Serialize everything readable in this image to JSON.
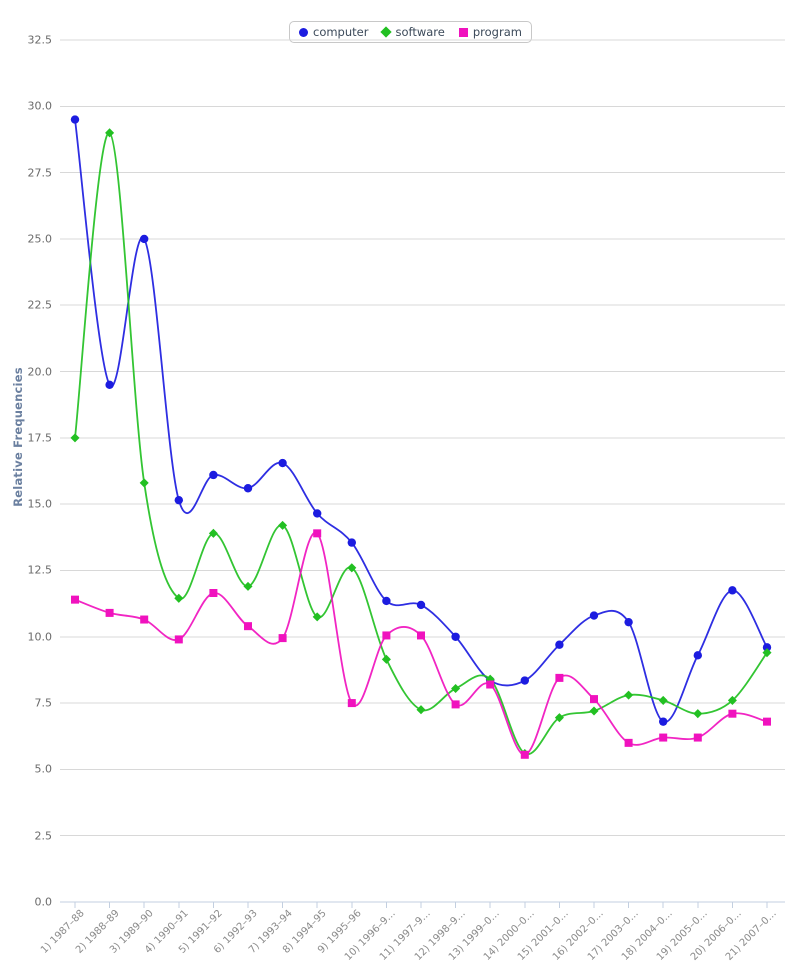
{
  "legend": {
    "position": "top-center",
    "items": [
      {
        "label": "computer",
        "color": "#1c1ce0",
        "marker": "circle-marker-icon"
      },
      {
        "label": "software",
        "color": "#22c022",
        "marker": "diamond-marker-icon"
      },
      {
        "label": "program",
        "color": "#f012be",
        "marker": "square-marker-icon"
      }
    ]
  },
  "chart_data": {
    "type": "line",
    "title": "",
    "xlabel": "",
    "ylabel": "Relative Frequencies",
    "ylim": [
      0.0,
      32.5
    ],
    "yticks": [
      "0.0",
      "2.5",
      "5.0",
      "7.5",
      "10.0",
      "12.5",
      "15.0",
      "17.5",
      "20.0",
      "22.5",
      "25.0",
      "27.5",
      "30.0",
      "32.5"
    ],
    "ytick_values": [
      0.0,
      2.5,
      5.0,
      7.5,
      10.0,
      12.5,
      15.0,
      17.5,
      20.0,
      22.5,
      25.0,
      27.5,
      30.0,
      32.5
    ],
    "grid": true,
    "interpolation": "spline",
    "categories": [
      "1) 1987–88",
      "2) 1988–89",
      "3) 1989–90",
      "4) 1990–91",
      "5) 1991–92",
      "6) 1992–93",
      "7) 1993–94",
      "8) 1994–95",
      "9) 1995–96",
      "10) 1996–9…",
      "11) 1997–9…",
      "12) 1998–9…",
      "13) 1999–0…",
      "14) 2000–0…",
      "15) 2001–0…",
      "16) 2002–0…",
      "17) 2003–0…",
      "18) 2004–0…",
      "19) 2005–0…",
      "20) 2006–0…",
      "21) 2007–0…"
    ],
    "series": [
      {
        "name": "computer",
        "color": "#1c1ce0",
        "marker": "circle",
        "values": [
          29.5,
          19.5,
          25.0,
          15.15,
          16.1,
          15.6,
          16.55,
          14.65,
          13.55,
          11.35,
          11.2,
          10.0,
          8.35,
          8.35,
          9.7,
          10.8,
          10.55,
          6.8,
          9.3,
          11.75,
          9.6
        ]
      },
      {
        "name": "software",
        "color": "#22c022",
        "marker": "diamond",
        "values": [
          17.5,
          29.0,
          15.8,
          11.45,
          13.9,
          11.9,
          14.2,
          10.75,
          12.6,
          9.15,
          7.25,
          8.05,
          8.4,
          5.6,
          6.95,
          7.2,
          7.8,
          7.6,
          7.1,
          7.6,
          9.4
        ]
      },
      {
        "name": "program",
        "color": "#f012be",
        "marker": "square",
        "values": [
          11.4,
          10.9,
          10.65,
          9.9,
          11.65,
          10.4,
          9.95,
          13.9,
          7.5,
          10.05,
          10.05,
          7.45,
          8.2,
          5.55,
          8.45,
          7.65,
          6.0,
          6.2,
          6.2,
          7.1,
          6.8
        ]
      }
    ]
  }
}
